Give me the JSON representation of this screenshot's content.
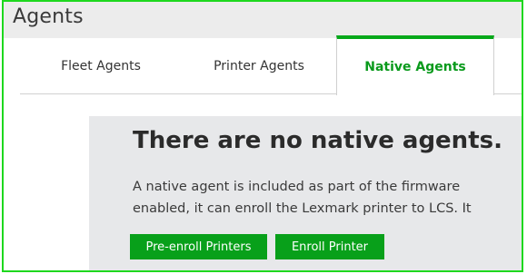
{
  "header": {
    "title": "Agents"
  },
  "tabs": [
    {
      "label": "Fleet Agents",
      "active": false
    },
    {
      "label": "Printer Agents",
      "active": false
    },
    {
      "label": "Native Agents",
      "active": true
    }
  ],
  "empty_state": {
    "title": "There are no native agents.",
    "description_line1": "A native agent is included as part of the firmware",
    "description_line2": "enabled, it can enroll the Lexmark printer to LCS. It",
    "buttons": {
      "pre_enroll": "Pre-enroll Printers",
      "enroll": "Enroll Printer"
    }
  },
  "colors": {
    "accent_green": "#08a01a",
    "active_tab_text": "#0a9a1c",
    "panel_background": "#e7e8ea",
    "header_background": "#ececec"
  }
}
